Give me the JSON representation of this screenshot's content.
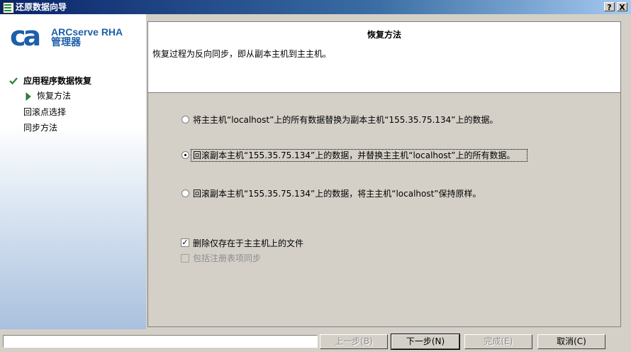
{
  "window": {
    "title": "还原数据向导",
    "help_label": "?",
    "close_label": "X"
  },
  "brand": {
    "product": "ARCserve RHA",
    "subtitle": "管理器",
    "logo_text": "ca"
  },
  "steps": [
    {
      "label": "应用程序数据恢复",
      "state": "completed"
    },
    {
      "label": "恢复方法",
      "state": "current"
    },
    {
      "label": "回滚点选择",
      "state": "pending"
    },
    {
      "label": "同步方法",
      "state": "pending"
    }
  ],
  "header": {
    "title": "恢复方法",
    "description": "恢复过程为反向同步，即从副本主机到主主机。"
  },
  "options": [
    {
      "label": "将主主机“localhost”上的所有数据替换为副本主机“155.35.75.134”上的数据。",
      "selected": false
    },
    {
      "label": "回滚副本主机“155.35.75.134”上的数据，并替换主主机“localhost”上的所有数据。",
      "selected": true
    },
    {
      "label": "回滚副本主机“155.35.75.134”上的数据，将主主机“localhost”保持原样。",
      "selected": false
    }
  ],
  "checkboxes": [
    {
      "label": "删除仅存在于主主机上的文件",
      "checked": true,
      "enabled": true
    },
    {
      "label": "包括注册表项同步",
      "checked": false,
      "enabled": false
    }
  ],
  "buttons": {
    "back": "上一步(B)",
    "next": "下一步(N)",
    "finish": "完成(E)",
    "cancel": "取消(C)"
  },
  "colors": {
    "brand_blue": "#1d5fa8",
    "titlebar": "#0a246a",
    "check_green": "#2e8b3a"
  }
}
